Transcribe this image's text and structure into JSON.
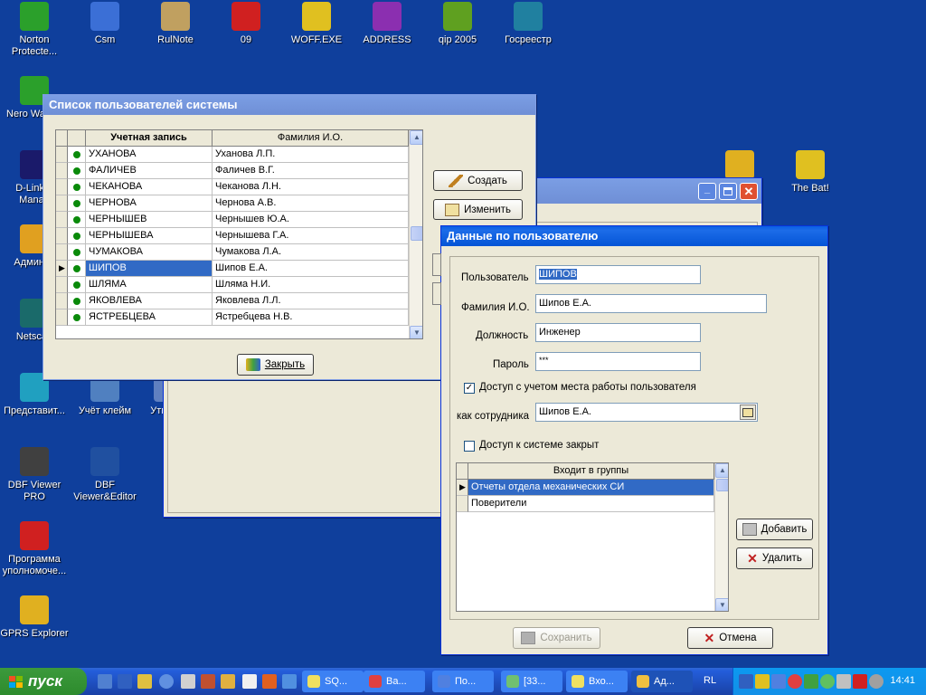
{
  "desktop": {
    "icons": [
      {
        "label": "Norton Protecte...",
        "icon": "norton-icon",
        "color": "#2ba02b"
      },
      {
        "label": "Csm",
        "icon": "network-icon",
        "color": "#3b6fd6"
      },
      {
        "label": "RulNote",
        "icon": "notepad-icon",
        "color": "#c0a060"
      },
      {
        "label": "09",
        "icon": "phone-icon",
        "color": "#d02020"
      },
      {
        "label": "WOFF.EXE",
        "icon": "face-icon",
        "color": "#e0c020"
      },
      {
        "label": "ADDRESS",
        "icon": "books-icon",
        "color": "#8b2fb0"
      },
      {
        "label": "qip 2005",
        "icon": "qip-icon",
        "color": "#5fa020"
      },
      {
        "label": "Госреестр",
        "icon": "computer-icon",
        "color": "#2080a0"
      },
      {
        "label": "Nero WaveE",
        "icon": "nero-icon",
        "color": "#2ba02b"
      },
      {
        "label": "D-Link A Manag",
        "icon": "dlink-icon",
        "color": "#1a1a6a"
      },
      {
        "label": "Админис",
        "icon": "admin-icon",
        "color": "#e0a020"
      },
      {
        "label": "Netscap",
        "icon": "netscape-icon",
        "color": "#1a6a6a"
      },
      {
        "label": "Представит...",
        "icon": "cubes-icon",
        "color": "#20a0c0"
      },
      {
        "label": "Учёт клейм",
        "icon": "barcode-icon",
        "color": "#5080c0"
      },
      {
        "label": "Ути пер",
        "icon": "util-icon",
        "color": "#6080c0"
      },
      {
        "label": "DBF Viewer PRO",
        "icon": "dbf-icon",
        "color": "#404040"
      },
      {
        "label": "DBF Viewer&Editor",
        "icon": "dbf-editor-icon",
        "color": "#2050a0"
      },
      {
        "label": "Программа уполномоче...",
        "icon": "flag-icon",
        "color": "#d02020"
      },
      {
        "label": "GPRS Explorer",
        "icon": "gprs-icon",
        "color": "#e0b020"
      },
      {
        "label": "The Bat!",
        "icon": "bat-icon",
        "color": "#e0c020"
      },
      {
        "label": "e",
        "icon": "folder-icon",
        "color": "#e0b020"
      }
    ]
  },
  "users_window": {
    "title": "Список пользователей системы",
    "columns": [
      "Учетная запись",
      "Фамилия И.О."
    ],
    "rows": [
      {
        "account": "УХАНОВА",
        "name": "Уханова Л.П."
      },
      {
        "account": "ФАЛИЧЕВ",
        "name": "Фаличев В.Г."
      },
      {
        "account": "ЧЕКАНОВА",
        "name": "Чеканова Л.Н."
      },
      {
        "account": "ЧЕРНОВА",
        "name": "Чернова А.В."
      },
      {
        "account": "ЧЕРНЫШЕВ",
        "name": "Чернышев Ю.А."
      },
      {
        "account": "ЧЕРНЫШЕВА",
        "name": "Чернышева Г.А."
      },
      {
        "account": "ЧУМАКОВА",
        "name": "Чумакова Л.А."
      },
      {
        "account": "ШИПОВ",
        "name": "Шипов Е.А."
      },
      {
        "account": "ШЛЯМА",
        "name": "Шляма Н.И."
      },
      {
        "account": "ЯКОВЛЕВА",
        "name": "Яковлева Л.Л."
      },
      {
        "account": "ЯСТРЕБЦЕВА",
        "name": "Ястребцева Н.В."
      }
    ],
    "selected_index": 7,
    "create_label": "Создать",
    "edit_label": "Изменить",
    "close_label": "Закрыть"
  },
  "user_data_window": {
    "title": "Данные по пользователю",
    "user_label": "Пользователь",
    "user_value": "ШИПОВ",
    "fio_label": "Фамилия И.О.",
    "fio_value": "Шипов Е.А.",
    "position_label": "Должность",
    "position_value": "Инженер",
    "password_label": "Пароль",
    "password_value": "***",
    "access_workplace_label": "Доступ с учетом места работы пользователя",
    "access_workplace_checked": true,
    "as_employee_label": "как сотрудника",
    "as_employee_value": "Шипов Е.А.",
    "access_closed_label": "Доступ к системе закрыт",
    "access_closed_checked": false,
    "groups_header": "Входит в группы",
    "groups": [
      "Отчеты отдела механических СИ",
      "Поверители"
    ],
    "add_label": "Добавить",
    "delete_label": "Удалить",
    "save_label": "Сохранить",
    "cancel_label": "Отмена"
  },
  "taskbar": {
    "start_label": "пуск",
    "tasks": [
      "SQ...",
      "Ва...",
      "По...",
      "[33...",
      "Вхо...",
      "Ад..."
    ],
    "active_task_index": 5,
    "lang": "RL",
    "clock": "14:41"
  }
}
